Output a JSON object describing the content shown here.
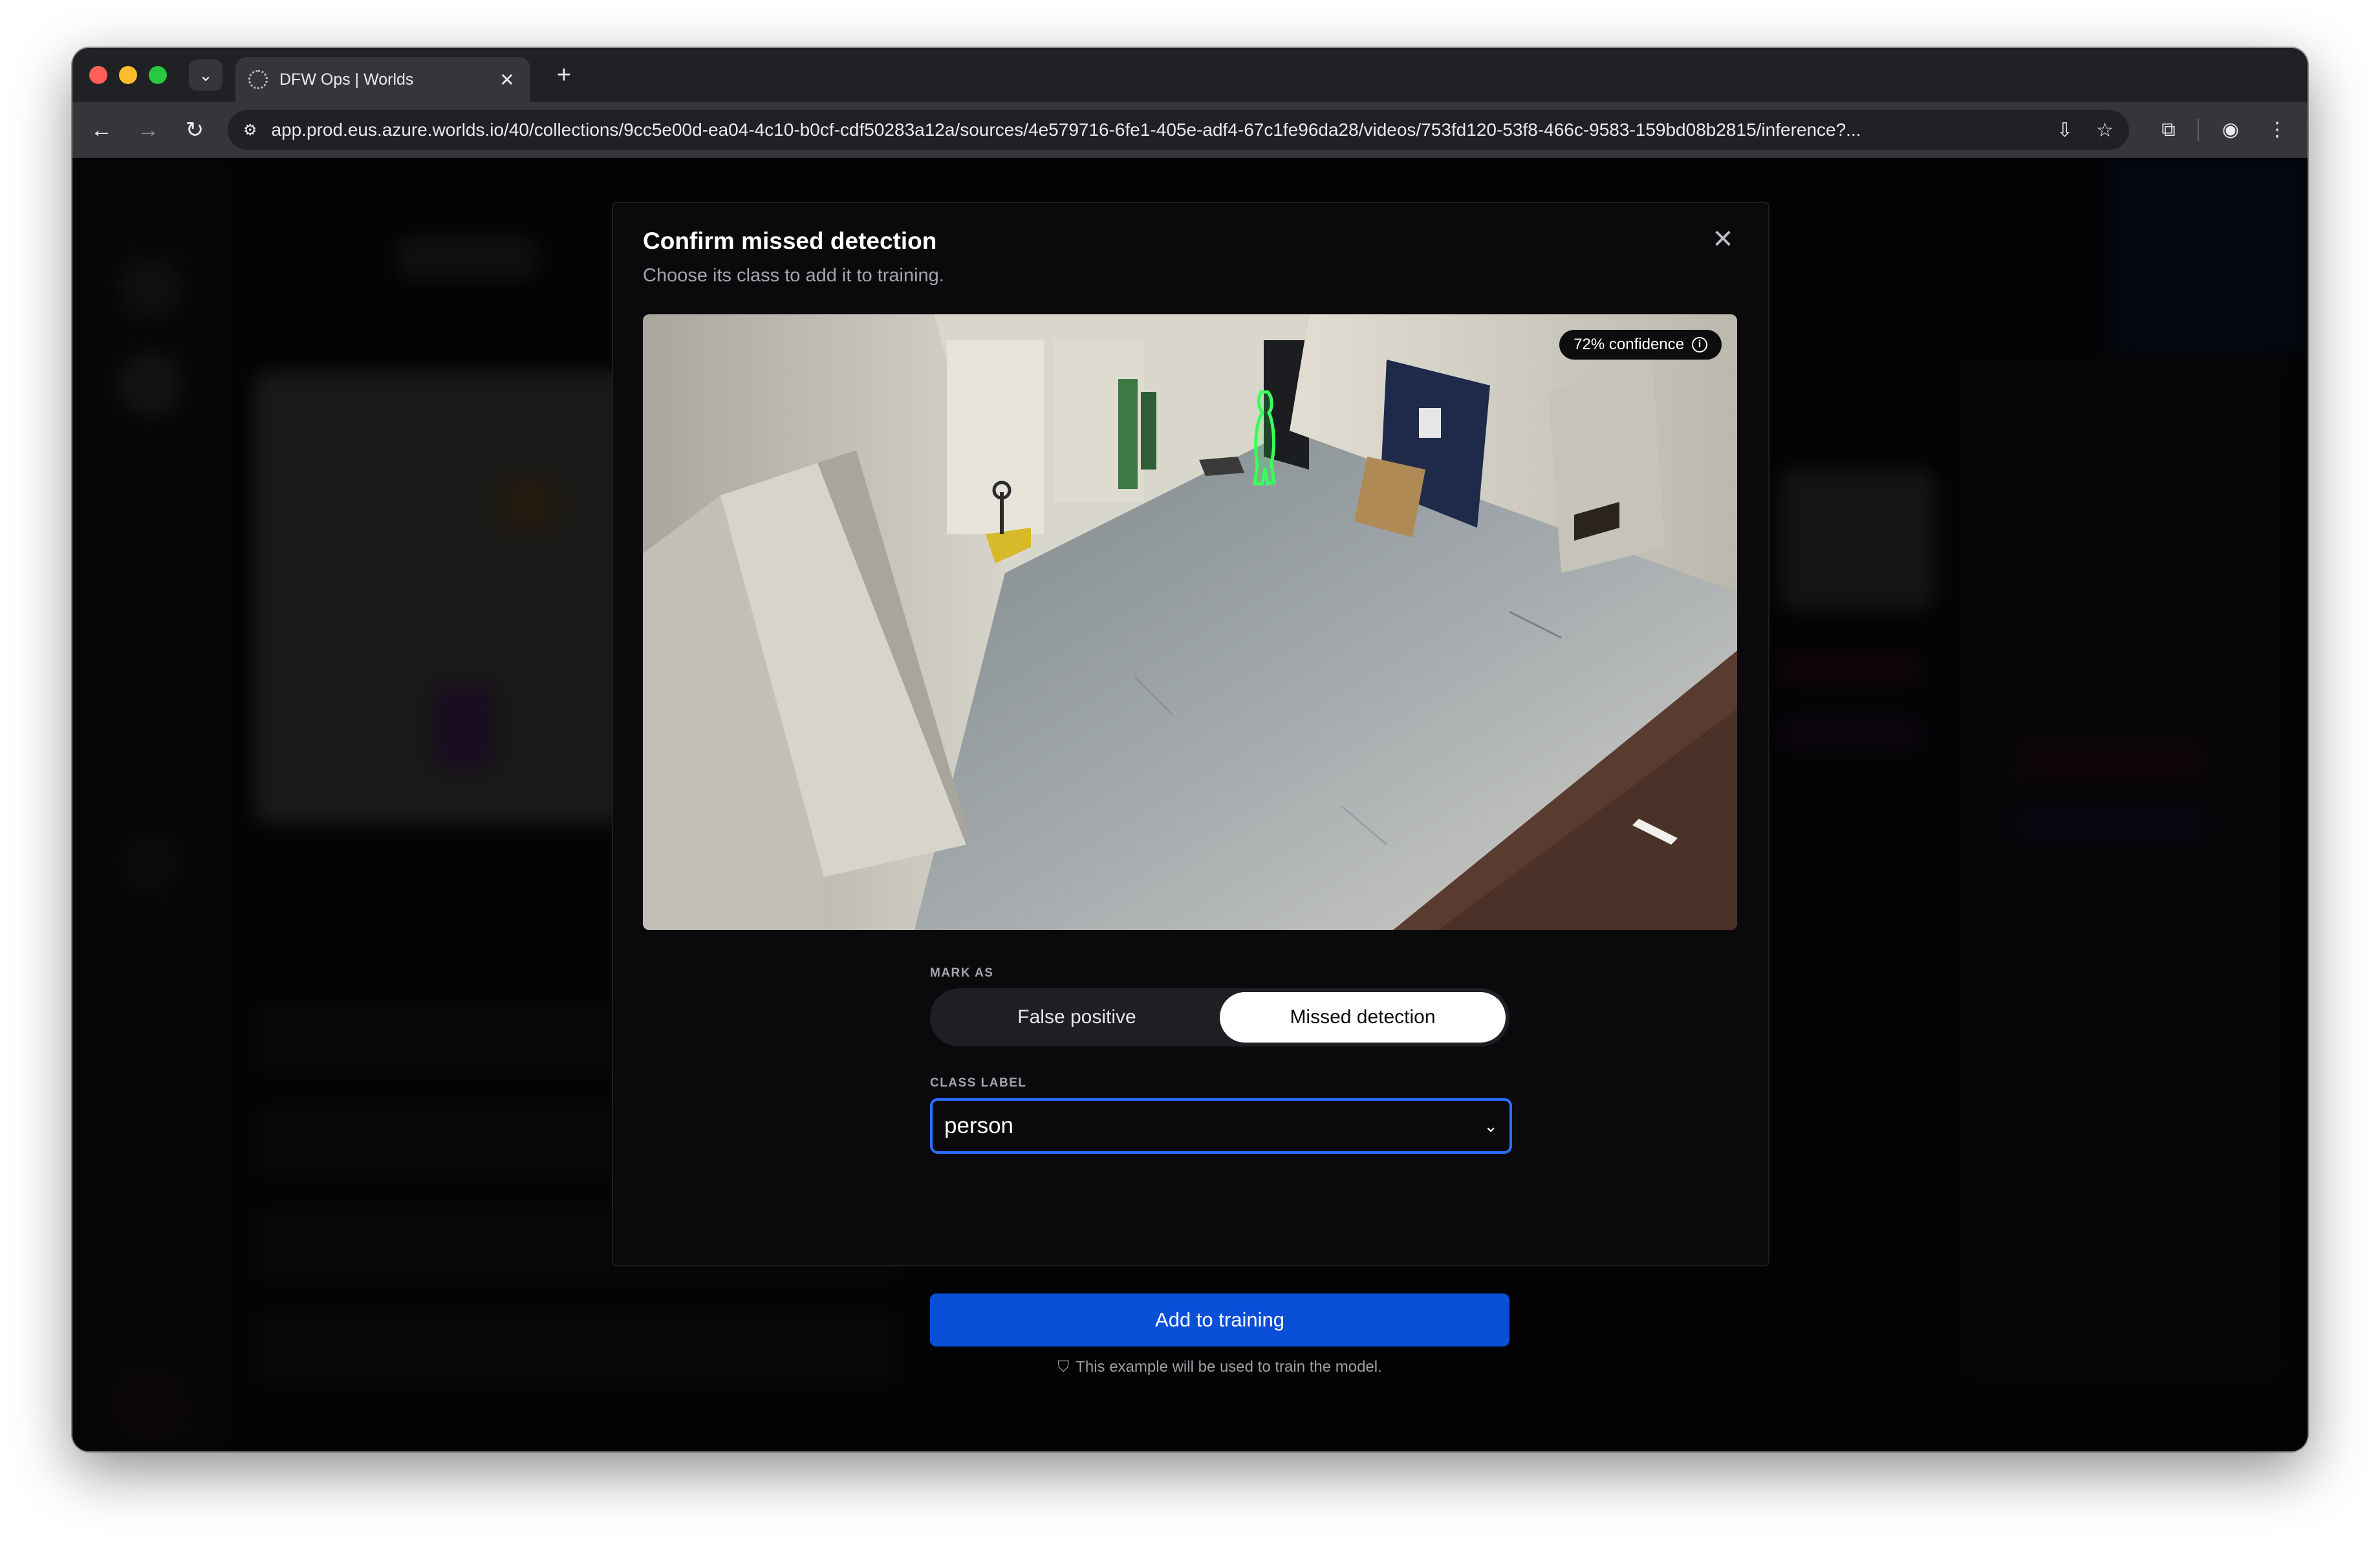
{
  "browser": {
    "tab_title": "DFW Ops | Worlds",
    "tab_close": "✕",
    "new_tab": "+",
    "url": "app.prod.eus.azure.worlds.io/40/collections/9cc5e00d-ea04-4c10-b0cf-cdf50283a12a/sources/4e579716-6fe1-405e-adf4-67c1fe96da28/videos/753fd120-53f8-466c-9583-159bd08b2815/inference?..."
  },
  "modal": {
    "title": "Confirm missed detection",
    "subtitle": "Choose its class to add it to training.",
    "close": "✕",
    "confidence_badge": "72% confidence",
    "mark_as_label": "MARK AS",
    "segments": [
      "False positive",
      "Missed detection"
    ],
    "selected_segment": "Missed detection",
    "class_label_label": "CLASS LABEL",
    "class_label_value": "person",
    "primary_button": "Add to training",
    "hint": "This example will be used to train the model."
  },
  "colors": {
    "accent": "#0a4fd8",
    "focus_ring": "#2a6fff",
    "detection_outline": "#39ff5a",
    "modal_bg": "#0a0a0c"
  }
}
